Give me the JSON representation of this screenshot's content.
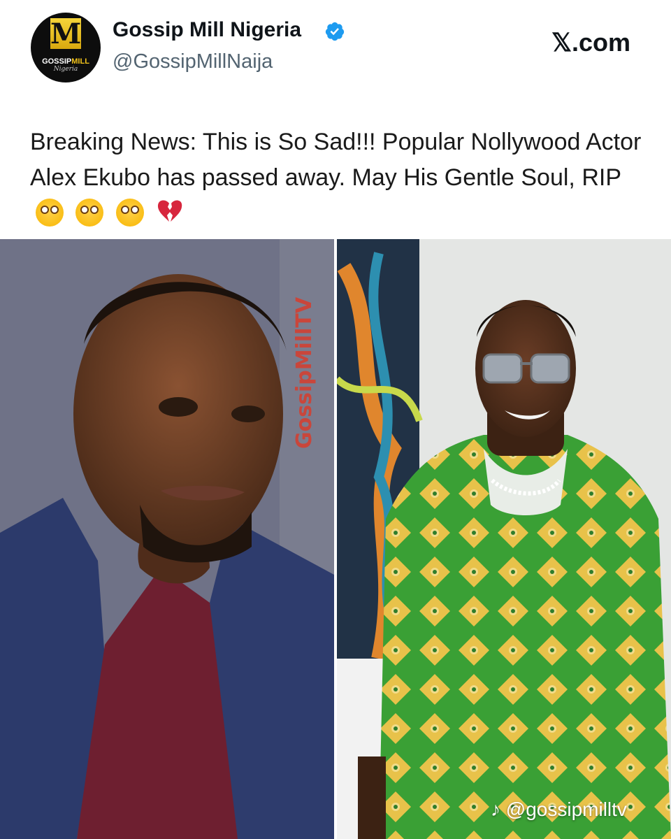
{
  "post": {
    "account_name": "Gossip Mill Nigeria",
    "handle": "@GossipMillNaija",
    "site": "𝕏.com",
    "text": "Breaking News: This is So Sad!!! Popular Nollywood Actor Alex Ekubo has passed away. May His Gentle Soul, RIP",
    "emojis": [
      "flushed-face",
      "flushed-face",
      "flushed-face",
      "broken-heart"
    ],
    "avatar": {
      "letter": "M",
      "brand_part1": "GOSSIP",
      "brand_part2": "MILL",
      "sub": "Nigeria"
    }
  },
  "overlay": {
    "watermark": "GossipMillTV",
    "tiktok_handle": "@gossipmilltv"
  },
  "colors": {
    "verified": "#1d9bf0",
    "watermark": "#c9463b",
    "handle": "#536471",
    "avatar_gold": "#f1c21b"
  }
}
